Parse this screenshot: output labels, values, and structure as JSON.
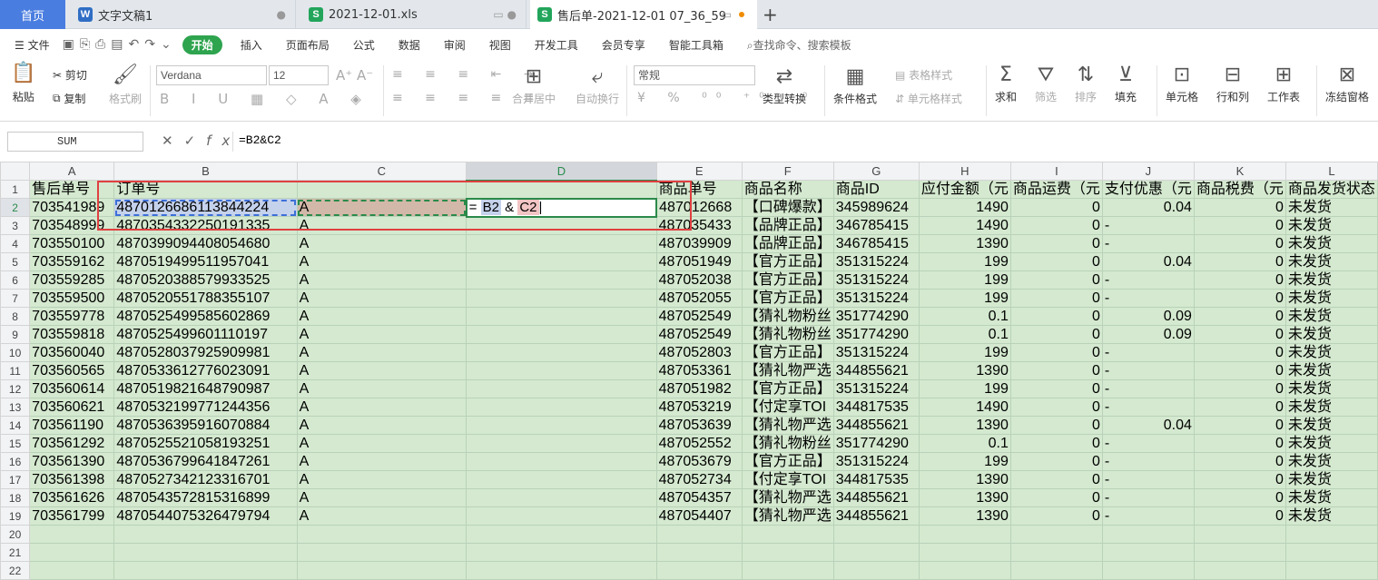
{
  "tabs": {
    "home": "首页",
    "doc": "文字文稿1",
    "xls": "2021-12-01.xls",
    "current": "售后单-2021-12-01 07_36_59"
  },
  "menu": {
    "file": "文件",
    "items": [
      "开始",
      "插入",
      "页面布局",
      "公式",
      "数据",
      "审阅",
      "视图",
      "开发工具",
      "会员专享",
      "智能工具箱"
    ],
    "search": "查找命令、搜索模板"
  },
  "toolbar": {
    "paste": "粘贴",
    "cut": "剪切",
    "copy": "复制",
    "format_painter": "格式刷",
    "font": "Verdana",
    "size": "12",
    "merge": "合并居中",
    "wrap": "自动换行",
    "number_format": "常规",
    "type_convert": "类型转换",
    "cond_format": "条件格式",
    "table_style": "表格样式",
    "cell_style": "单元格样式",
    "sum": "求和",
    "filter": "筛选",
    "sort": "排序",
    "fill": "填充",
    "cell": "单元格",
    "rowcol": "行和列",
    "sheet": "工作表",
    "freeze": "冻结窗格"
  },
  "formula_bar": {
    "name_box": "SUM",
    "formula": "=B2&C2"
  },
  "sheet": {
    "columns": [
      "A",
      "B",
      "C",
      "D",
      "E",
      "F",
      "G",
      "H",
      "I",
      "J",
      "K",
      "L"
    ],
    "header": [
      "售后单号",
      "订单号",
      "",
      "",
      "商品单号",
      "商品名称",
      "商品ID",
      "应付金额（元",
      "商品运费（元",
      "支付优惠（元",
      "商品税费（元",
      "商品发货状态"
    ],
    "editing_formula": {
      "eq": "=",
      "ref1": "B2",
      "amp": "&",
      "ref2": "C2"
    },
    "rows": [
      [
        "703541989",
        "487012668611384422​4",
        "A",
        "",
        "487012668",
        "【口碑爆款】",
        "345989624",
        "1490",
        "0",
        "0.04",
        "0",
        "未发货"
      ],
      [
        "703548999",
        "487035433225019133​5",
        "A",
        "",
        "487035433",
        "【品牌正品】",
        "346785415",
        "1490",
        "0",
        "-",
        "0",
        "未发货"
      ],
      [
        "703550100",
        "487039909440805468​0",
        "A",
        "",
        "487039909",
        "【品牌正品】",
        "346785415",
        "1390",
        "0",
        "-",
        "0",
        "未发货"
      ],
      [
        "703559162",
        "487051949951195704​1",
        "A",
        "",
        "487051949",
        "【官方正品】",
        "351315224",
        "199",
        "0",
        "0.04",
        "0",
        "未发货"
      ],
      [
        "703559285",
        "487052038857993352​5",
        "A",
        "",
        "487052038",
        "【官方正品】",
        "351315224",
        "199",
        "0",
        "-",
        "0",
        "未发货"
      ],
      [
        "703559500",
        "487052055178835510​7",
        "A",
        "",
        "487052055",
        "【官方正品】",
        "351315224",
        "199",
        "0",
        "-",
        "0",
        "未发货"
      ],
      [
        "703559778",
        "487052549958560286​9",
        "A",
        "",
        "487052549",
        "【猜礼物粉丝",
        "351774290",
        "0.1",
        "0",
        "0.09",
        "0",
        "未发货"
      ],
      [
        "703559818",
        "487052549960111019​7",
        "A",
        "",
        "487052549",
        "【猜礼物粉丝",
        "351774290",
        "0.1",
        "0",
        "0.09",
        "0",
        "未发货"
      ],
      [
        "703560040",
        "487052803792590998​1",
        "A",
        "",
        "487052803",
        "【官方正品】",
        "351315224",
        "199",
        "0",
        "-",
        "0",
        "未发货"
      ],
      [
        "703560565",
        "487053361277602309​1",
        "A",
        "",
        "487053361",
        "【猜礼物严选",
        "344855621",
        "1390",
        "0",
        "-",
        "0",
        "未发货"
      ],
      [
        "703560614",
        "487051982164879098​7",
        "A",
        "",
        "487051982",
        "【官方正品】",
        "351315224",
        "199",
        "0",
        "-",
        "0",
        "未发货"
      ],
      [
        "703560621",
        "487053219977124435​6",
        "A",
        "",
        "487053219",
        "【付定享TOI",
        "344817535",
        "1490",
        "0",
        "-",
        "0",
        "未发货"
      ],
      [
        "703561190",
        "487053639591607088​4",
        "A",
        "",
        "487053639",
        "【猜礼物严选",
        "344855621",
        "1390",
        "0",
        "0.04",
        "0",
        "未发货"
      ],
      [
        "703561292",
        "487052552105819325​1",
        "A",
        "",
        "487052552",
        "【猜礼物粉丝",
        "351774290",
        "0.1",
        "0",
        "-",
        "0",
        "未发货"
      ],
      [
        "703561390",
        "487053679964184726​1",
        "A",
        "",
        "487053679",
        "【官方正品】",
        "351315224",
        "199",
        "0",
        "-",
        "0",
        "未发货"
      ],
      [
        "703561398",
        "487052734212331670​1",
        "A",
        "",
        "487052734",
        "【付定享TOI",
        "344817535",
        "1390",
        "0",
        "-",
        "0",
        "未发货"
      ],
      [
        "703561626",
        "487054357281531689​9",
        "A",
        "",
        "487054357",
        "【猜礼物严选",
        "344855621",
        "1390",
        "0",
        "-",
        "0",
        "未发货"
      ],
      [
        "703561799",
        "487054407532647979​4",
        "A",
        "",
        "487054407",
        "【猜礼物严选",
        "344855621",
        "1390",
        "0",
        "-",
        "0",
        "未发货"
      ]
    ],
    "row_numbers": [
      "1",
      "2",
      "3",
      "4",
      "5",
      "6",
      "7",
      "8",
      "9",
      "10",
      "11",
      "12",
      "13",
      "14",
      "15",
      "16",
      "17",
      "18",
      "19",
      "20",
      "21",
      "22"
    ]
  },
  "colors": {
    "accent": "#2ea44f",
    "selection_green": "#2a8a4a",
    "highlight_red": "#e04040",
    "cell_fill": "#d4e9cf"
  }
}
